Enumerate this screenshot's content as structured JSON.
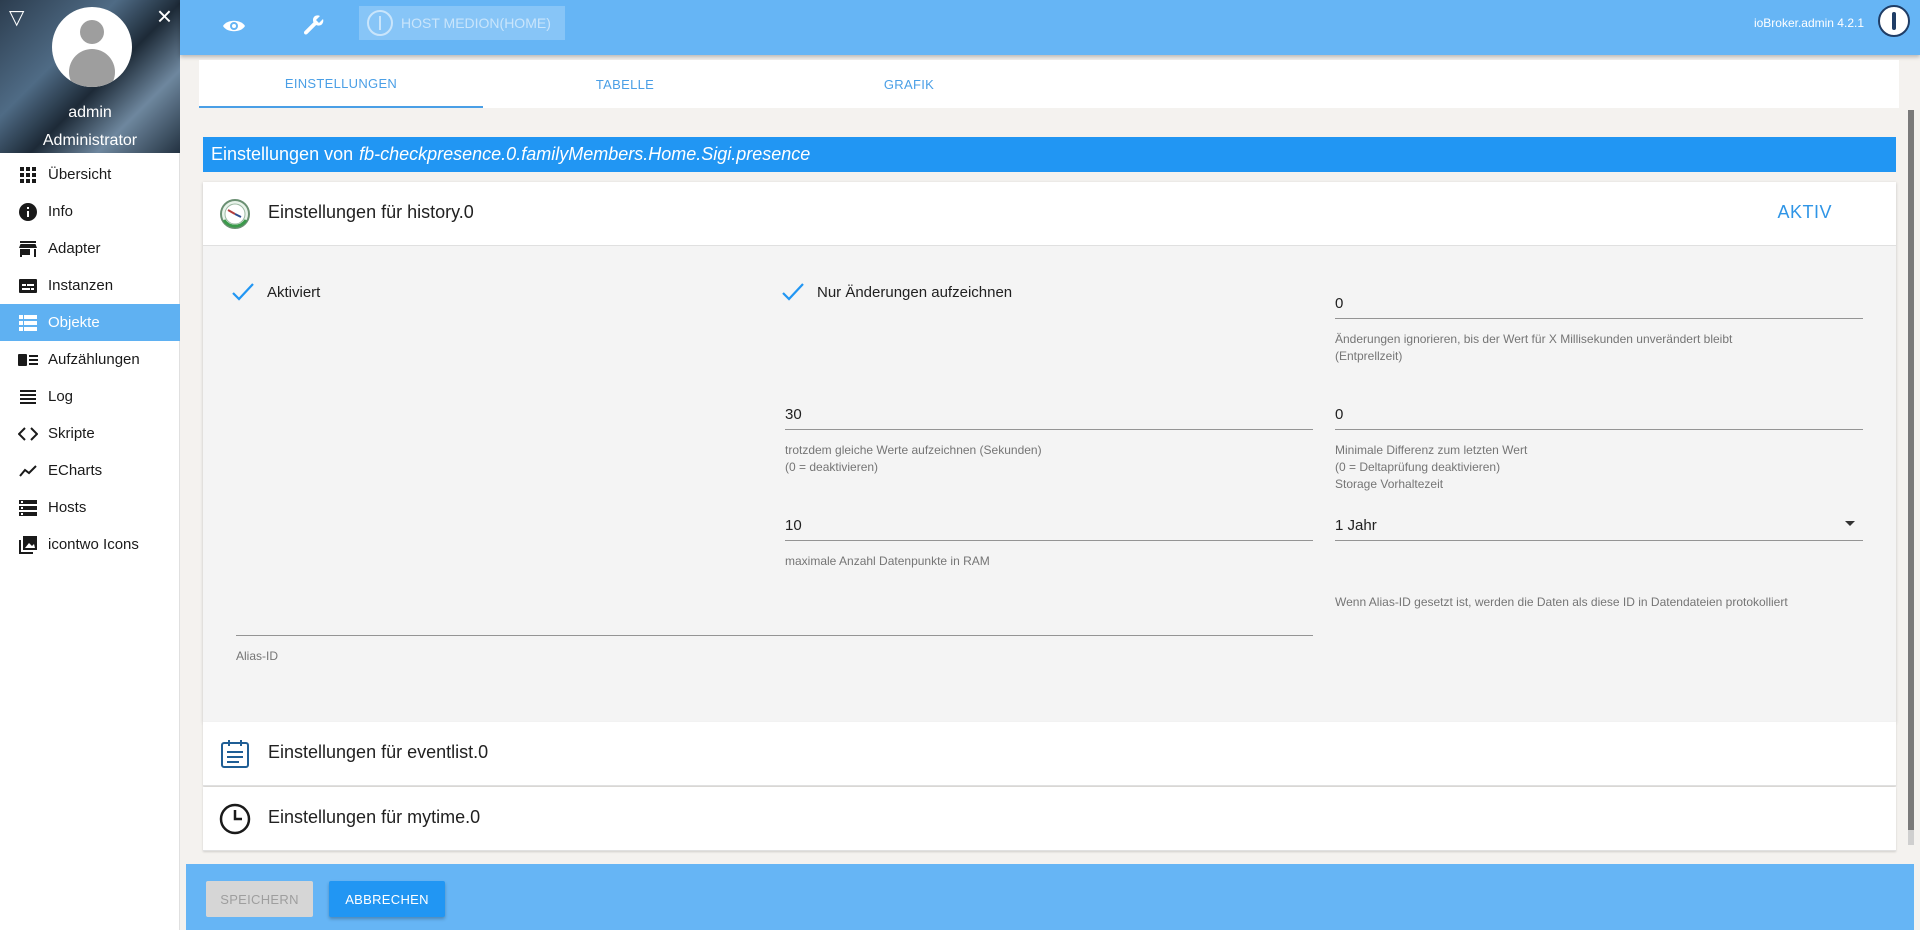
{
  "sidebar": {
    "user_name": "admin",
    "user_role": "Administrator",
    "items": [
      {
        "label": "Übersicht",
        "icon": "grid-icon"
      },
      {
        "label": "Info",
        "icon": "info-icon"
      },
      {
        "label": "Adapter",
        "icon": "store-icon"
      },
      {
        "label": "Instanzen",
        "icon": "instances-icon"
      },
      {
        "label": "Objekte",
        "icon": "list-icon"
      },
      {
        "label": "Aufzählungen",
        "icon": "enum-icon"
      },
      {
        "label": "Log",
        "icon": "log-icon"
      },
      {
        "label": "Skripte",
        "icon": "code-icon"
      },
      {
        "label": "ECharts",
        "icon": "chart-icon"
      },
      {
        "label": "Hosts",
        "icon": "hosts-icon"
      },
      {
        "label": "icontwo Icons",
        "icon": "image-icon"
      }
    ],
    "active_index": 4
  },
  "topbar": {
    "host_label": "HOST MEDION(HOME)",
    "version": "ioBroker.admin 4.2.1"
  },
  "tabs": [
    {
      "label": "EINSTELLUNGEN",
      "active": true
    },
    {
      "label": "TABELLE",
      "active": false
    },
    {
      "label": "GRAFIK",
      "active": false
    }
  ],
  "settings": {
    "title_prefix": "Einstellungen von",
    "object_id": "fb-checkpresence.0.familyMembers.Home.Sigi.presence",
    "history": {
      "title": "Einstellungen für history.0",
      "status": "AKTIV",
      "enabled_label": "Aktiviert",
      "changes_only_label": "Nur Änderungen aufzeichnen",
      "debounce_value": "0",
      "debounce_help_1": "Änderungen ignorieren, bis der Wert für X Millisekunden unverändert bleibt",
      "debounce_help_2": "(Entprellzeit)",
      "same_values_value": "30",
      "same_values_help_1": "trotzdem gleiche Werte aufzeichnen (Sekunden)",
      "same_values_help_2": "(0 = deaktivieren)",
      "min_diff_value": "0",
      "min_diff_help_1": "Minimale Differenz zum letzten Wert",
      "min_diff_help_2": "(0 = Deltaprüfung deaktivieren)",
      "storage_label": "Storage Vorhaltezeit",
      "max_points_value": "10",
      "max_points_help": "maximale Anzahl Datenpunkte in RAM",
      "retention_value": "1 Jahr",
      "alias_help": "Wenn Alias-ID gesetzt ist, werden die Daten als diese ID in Datendateien protokolliert",
      "alias_value": "",
      "alias_label": "Alias-ID"
    },
    "eventlist_title": "Einstellungen für eventlist.0",
    "mytime_title": "Einstellungen für mytime.0"
  },
  "footer": {
    "save_label": "SPEICHERN",
    "cancel_label": "ABBRECHEN"
  },
  "colors": {
    "primary": "#2196f3",
    "topbar": "#66b5f5",
    "active_nav": "#5fb1f2"
  }
}
